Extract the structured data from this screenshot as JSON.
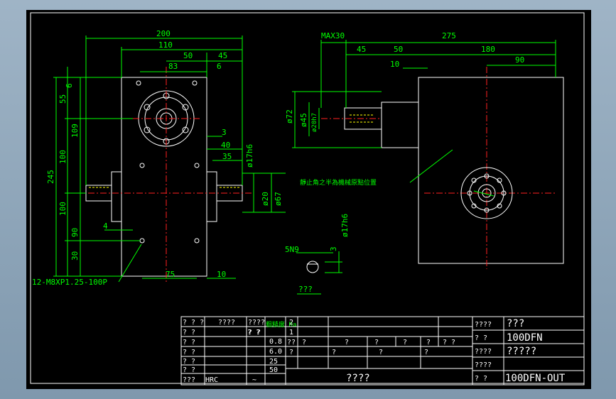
{
  "colors": {
    "background": "#000000",
    "outline": "#ffffff",
    "dimension": "#00ff00",
    "centerline": "#ff2020",
    "hidden": "#ffff00",
    "frame": "#8da4b8"
  },
  "front_view": {
    "dim_top": [
      "200",
      "110",
      "50",
      "45",
      "83",
      "6"
    ],
    "dim_left": [
      "6",
      "55",
      "109",
      "100",
      "245",
      "100",
      "90",
      "30"
    ],
    "dim_right": [
      "3",
      "40",
      "35",
      "ø17h6",
      "ø20",
      "ø67"
    ],
    "dim_bottom": [
      "4",
      "75",
      "10"
    ],
    "callout": "12-M8XP1.25-100P"
  },
  "side_view": {
    "dim_top": [
      "MAX30",
      "275",
      "45",
      "50",
      "180",
      "10",
      "90"
    ],
    "dim_left": [
      "ø72",
      "ø45",
      "ø20h7"
    ],
    "note": "靜止角之半為機械原點位置"
  },
  "key_detail": {
    "labels": [
      "5N9",
      "3",
      "ø17h6"
    ],
    "title": "???"
  },
  "title_block": {
    "material_rows": [
      [
        "? ? ?",
        "????",
        "????"
      ],
      [
        "? ?",
        "",
        "? ?"
      ],
      [
        "? ?",
        "",
        ""
      ],
      [
        "? ?",
        "",
        ""
      ],
      [
        "? ?",
        "",
        ""
      ],
      [
        "? ?",
        "",
        ""
      ],
      [
        "???",
        "HRC",
        "~"
      ]
    ],
    "roughness_header": "粗糙度 Ra",
    "roughness": [
      "0.8",
      "6.0",
      "25",
      "50",
      "? ?"
    ],
    "revision_numbers": [
      "2",
      "1"
    ],
    "revision_header": [
      "??",
      "?",
      "?",
      "?",
      "?",
      "?",
      "? ?"
    ],
    "sign_row": [
      "?",
      "?",
      "?",
      "?"
    ],
    "company": "????",
    "right_block": [
      [
        "????",
        "???"
      ],
      [
        "?  ?",
        "100DFN"
      ],
      [
        "????",
        "?????"
      ],
      [
        "????",
        ""
      ],
      [
        "?  ?",
        "100DFN-OUT"
      ]
    ]
  }
}
